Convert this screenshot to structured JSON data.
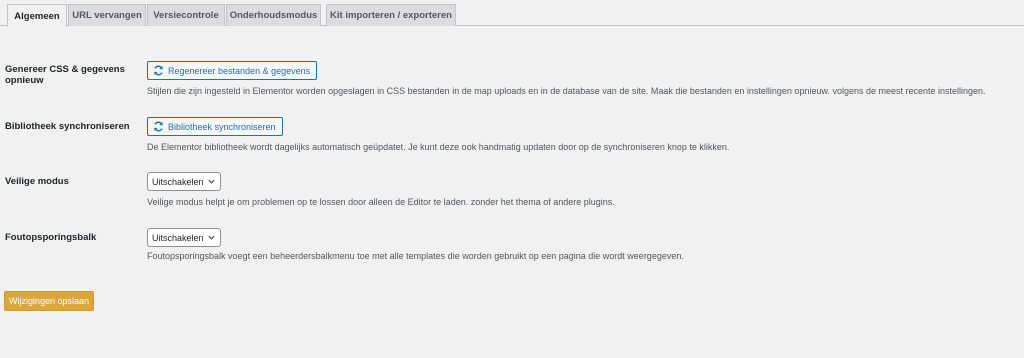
{
  "tabs": [
    {
      "label": "Algemeen",
      "active": true
    },
    {
      "label": "URL vervangen",
      "active": false
    },
    {
      "label": "Versiecontrole",
      "active": false
    },
    {
      "label": "Onderhoudsmodus",
      "active": false
    },
    {
      "label": "Kit importeren / exporteren",
      "active": false
    }
  ],
  "regenerate": {
    "label_line1": "Genereer CSS & gegevens",
    "label_line2": "opnieuw",
    "button": "Regenereer bestanden & gegevens",
    "description": "Stijlen die zijn ingesteld in Elementor worden opgeslagen in CSS bestanden in de map uploads en in de database van de site. Maak die bestanden en instellingen opnieuw. volgens de meest recente instellingen."
  },
  "library_sync": {
    "label": "Bibliotheek synchroniseren",
    "button": "Bibliotheek synchroniseren",
    "description": "De Elementor bibliotheek wordt dagelijks automatisch geüpdatet. Je kunt deze ook handmatig updaten door op de synchroniseren knop te klikken."
  },
  "safe_mode": {
    "label": "Veilige modus",
    "selected": "Uitschakelen",
    "description": "Veilige modus helpt je om problemen op te lossen door alleen de Editor te laden. zonder het thema of andere plugins."
  },
  "debug_bar": {
    "label": "Foutopsporingsbalk",
    "selected": "Uitschakelen",
    "description": "Foutopsporingsbalk voegt een beheerdersbalkmenu toe met alle templates die worden gebruikt op een pagina die wordt weergegeven."
  },
  "save_button": "Wijzigingen opslaan",
  "colors": {
    "accent": "#2271b1",
    "save_button": "#dba63b",
    "background": "#f1f1f1"
  }
}
